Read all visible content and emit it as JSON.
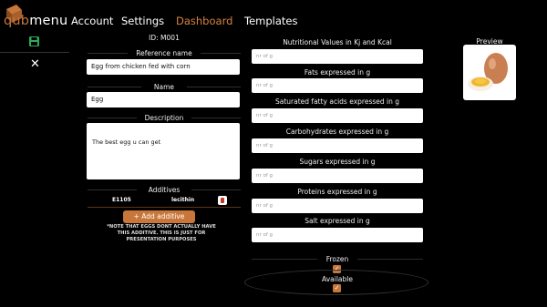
{
  "app": {
    "logo": {
      "prefix": "qub",
      "suffix": "menu"
    },
    "nav": [
      "Account",
      "Settings",
      "Dashboard",
      "Templates"
    ],
    "active_nav": "Dashboard",
    "colors": {
      "accent": "#c8763a",
      "active_nav": "#d9823f",
      "background": "#000000",
      "save_icon": "#2eaa57"
    }
  },
  "sidebar": {
    "save_icon": "save-icon",
    "close_icon": "close-icon",
    "close_glyph": "✕"
  },
  "form": {
    "id_label": "ID: M001",
    "reference_name_label": "Reference name",
    "reference_name_value": "Egg from chicken fed with corn",
    "name_label": "Name",
    "name_value": "Egg",
    "description_label": "Description",
    "description_value": "The best egg  u can get",
    "additives_label": "Additives",
    "additives": [
      {
        "code": "E1105",
        "name": "lecithin"
      }
    ],
    "add_additive_label": "+ Add additive",
    "note": "*NOTE THAT EGGS DONT ACTUALLY HAVE THIS ADDITIVE. THIS IS JUST FOR PRESENTATION PURPOSES"
  },
  "nutrition": {
    "fields": [
      {
        "label": "Nutritional Values in Kj and Kcal",
        "placeholder": "nr of g"
      },
      {
        "label": "Fats expressed in g",
        "placeholder": "nr of g"
      },
      {
        "label": "Saturated fatty acids expressed in g",
        "placeholder": "nr of g"
      },
      {
        "label": "Carbohydrates expressed in g",
        "placeholder": "nr of g"
      },
      {
        "label": "Sugars expressed in g",
        "placeholder": "nr of g"
      },
      {
        "label": "Proteins expressed in g",
        "placeholder": "nr of g"
      },
      {
        "label": "Salt expressed in g",
        "placeholder": "nr of g"
      }
    ],
    "frozen_label": "Frozen",
    "frozen_checked": true,
    "available_label": "Available",
    "available_checked": true,
    "check_glyph": "✓"
  },
  "preview": {
    "label": "Preview",
    "image": "egg-image"
  }
}
